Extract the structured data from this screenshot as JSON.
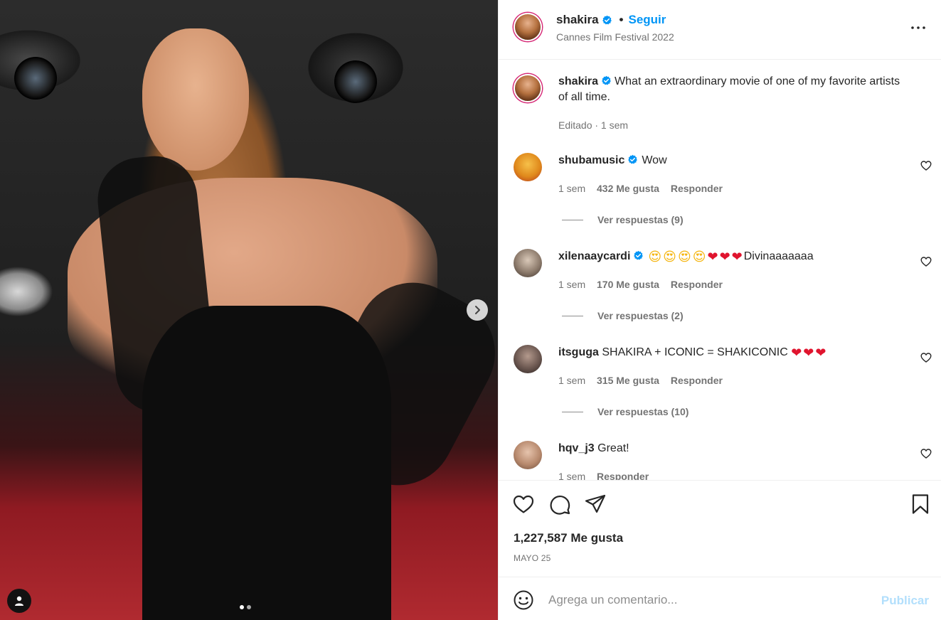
{
  "post": {
    "username": "shakira",
    "verified": true,
    "follow_label": "Seguir",
    "separator": "•",
    "location": "Cannes Film Festival 2022",
    "caption": {
      "username": "shakira",
      "text": "What an extraordinary movie of one of my favorite artists of all time.",
      "meta": "Editado · 1 sem"
    },
    "carousel": {
      "slides": 2,
      "active": 1
    }
  },
  "comments": [
    {
      "username": "shubamusic",
      "verified": true,
      "text": "Wow",
      "time": "1 sem",
      "likes": "432 Me gusta",
      "reply_label": "Responder",
      "view_replies": "Ver respuestas (9)",
      "avatar_color": "#f2a81d"
    },
    {
      "username": "xilenaaycardi",
      "verified": true,
      "emojis": [
        "😍",
        "😍",
        "😍",
        "😍",
        "❤",
        "❤",
        "❤"
      ],
      "text": "Divinaaaaaaa",
      "time": "1 sem",
      "likes": "170 Me gusta",
      "reply_label": "Responder",
      "view_replies": "Ver respuestas (2)",
      "avatar_color": "#b7a89a"
    },
    {
      "username": "itsguga",
      "verified": false,
      "text": "SHAKIRA + ICONIC = SHAKICONIC",
      "emojis": [
        "❤",
        "❤",
        "❤"
      ],
      "time": "1 sem",
      "likes": "315 Me gusta",
      "reply_label": "Responder",
      "view_replies": "Ver respuestas (10)",
      "avatar_color": "#6e5f58"
    },
    {
      "username": "hqv_j3",
      "verified": false,
      "text": "Great!",
      "time": "1 sem",
      "likes": "",
      "reply_label": "Responder",
      "avatar_color": "#c8a08a"
    }
  ],
  "actions": {
    "likes": "1,227,587 Me gusta",
    "date": "MAYO 25",
    "icons": [
      "heart-icon",
      "comment-icon",
      "share-icon",
      "bookmark-icon"
    ]
  },
  "composer": {
    "placeholder": "Agrega un comentario...",
    "publish_label": "Publicar"
  },
  "colors": {
    "accent": "#0095f6",
    "publish_disabled": "#b2dffc",
    "muted": "#737373",
    "heart": "#e0142e"
  }
}
